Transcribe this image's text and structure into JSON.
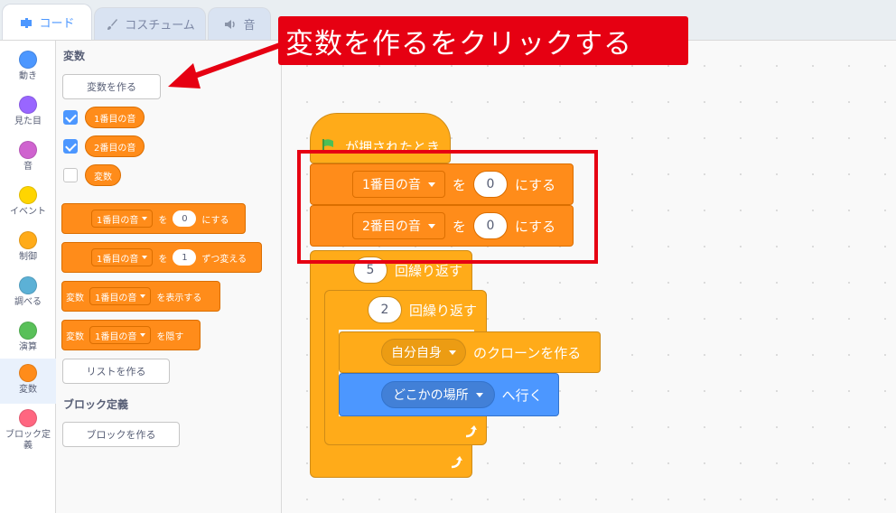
{
  "tabs": [
    {
      "label": "コード",
      "icon": "code-icon",
      "active": true
    },
    {
      "label": "コスチューム",
      "icon": "brush-icon",
      "active": false
    },
    {
      "label": "音",
      "icon": "speaker-icon",
      "active": false
    }
  ],
  "categories": [
    {
      "label": "動き",
      "color": "#4c97ff"
    },
    {
      "label": "見た目",
      "color": "#9966ff"
    },
    {
      "label": "音",
      "color": "#cf63cf"
    },
    {
      "label": "イベント",
      "color": "#ffd500"
    },
    {
      "label": "制御",
      "color": "#ffab19"
    },
    {
      "label": "調べる",
      "color": "#5cb1d6"
    },
    {
      "label": "演算",
      "color": "#59c059"
    },
    {
      "label": "変数",
      "color": "#ff8c1a"
    },
    {
      "label": "ブロック定義",
      "color": "#ff6680"
    }
  ],
  "flyout": {
    "heading_variables": "変数",
    "make_variable": "変数を作る",
    "variables": [
      {
        "name": "1番目の音",
        "checked": true
      },
      {
        "name": "2番目の音",
        "checked": true
      },
      {
        "name": "変数",
        "checked": false
      }
    ],
    "set_block": {
      "var": "1番目の音",
      "to": "を",
      "value": "0",
      "suffix": "にする"
    },
    "change_block": {
      "var": "1番目の音",
      "to": "を",
      "value": "1",
      "suffix": "ずつ変える"
    },
    "show_block": {
      "prefix": "変数",
      "var": "1番目の音",
      "suffix": "を表示する"
    },
    "hide_block": {
      "prefix": "変数",
      "var": "1番目の音",
      "suffix": "を隠す"
    },
    "make_list": "リストを作る",
    "heading_blocks": "ブロック定義",
    "make_block": "ブロックを作る"
  },
  "script": {
    "hat": "が押されたとき",
    "set1": {
      "var": "1番目の音",
      "to": "を",
      "value": "0",
      "suffix": "にする"
    },
    "set2": {
      "var": "2番目の音",
      "to": "を",
      "value": "0",
      "suffix": "にする"
    },
    "repeat_outer": {
      "value": "5",
      "label": "回繰り返す"
    },
    "repeat_inner": {
      "value": "2",
      "label": "回繰り返す"
    },
    "clone": {
      "target": "自分自身",
      "suffix": "のクローンを作る"
    },
    "goto": {
      "target": "どこかの場所",
      "suffix": "へ行く"
    }
  },
  "annotation": {
    "callout": "変数を作るをクリックする",
    "color": "#e60012"
  }
}
